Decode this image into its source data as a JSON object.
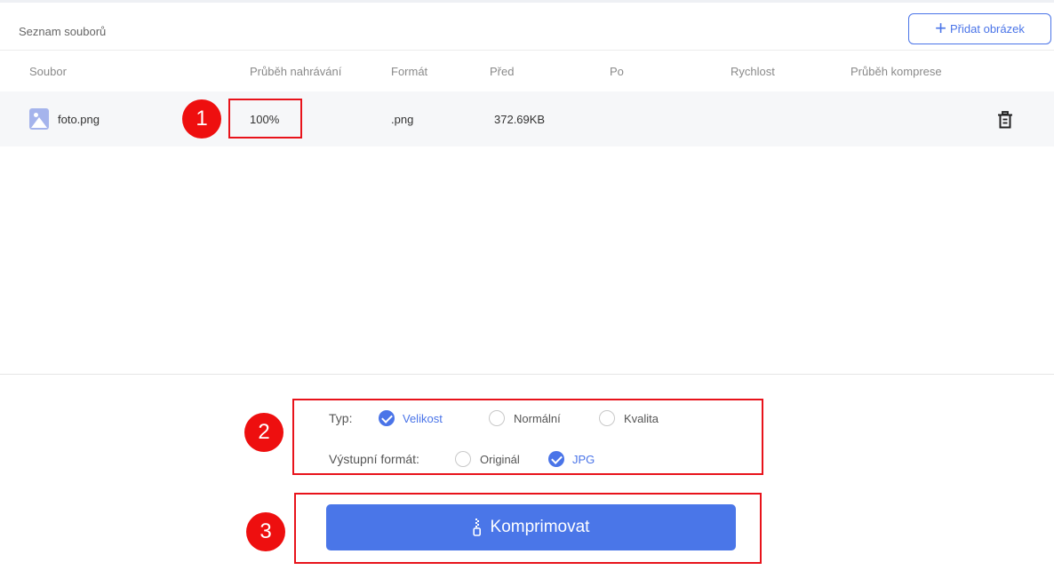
{
  "header": {
    "title": "Seznam souborů",
    "add_button": "Přidat obrázek"
  },
  "table": {
    "columns": [
      "Soubor",
      "Průběh nahrávání",
      "Formát",
      "Před",
      "Po",
      "Rychlost",
      "Průběh komprese"
    ],
    "rows": [
      {
        "name": "foto.png",
        "upload_progress": "100%",
        "format": ".png",
        "before": "372.69KB",
        "after": "",
        "speed": "",
        "compress_progress": ""
      }
    ]
  },
  "options": {
    "type_label": "Typ:",
    "type_options": [
      "Velikost",
      "Normální",
      "Kvalita"
    ],
    "type_selected": "Velikost",
    "format_label": "Výstupní formát:",
    "format_options": [
      "Originál",
      "JPG"
    ],
    "format_selected": "JPG"
  },
  "compress_button": "Komprimovat",
  "annotations": [
    "1",
    "2",
    "3"
  ],
  "colors": {
    "accent": "#4a74e8",
    "annotation_red": "#e8131b"
  },
  "icons": [
    "plus-icon",
    "image-file-icon",
    "trash-icon",
    "zip-icon",
    "check-icon"
  ]
}
